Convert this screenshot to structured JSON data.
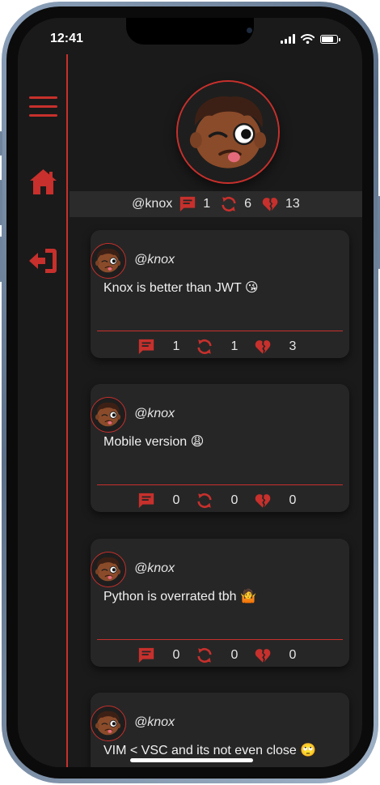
{
  "status_bar": {
    "time": "12:41",
    "battery_level": 0.9
  },
  "sidebar": {
    "items": [
      {
        "icon": "hamburger-menu-icon"
      },
      {
        "icon": "home-icon"
      },
      {
        "icon": "sign-out-icon"
      }
    ]
  },
  "profile": {
    "handle": "@knox",
    "stats": {
      "comments": "1",
      "reposts": "6",
      "dislikes": "13"
    }
  },
  "posts": [
    {
      "user": "@knox",
      "text": "Knox is better than JWT 😘",
      "comments": "1",
      "reposts": "1",
      "dislikes": "3"
    },
    {
      "user": "@knox",
      "text": "Mobile version 😩",
      "comments": "0",
      "reposts": "0",
      "dislikes": "0"
    },
    {
      "user": "@knox",
      "text": "Python is overrated tbh 🤷",
      "comments": "0",
      "reposts": "0",
      "dislikes": "0"
    },
    {
      "user": "@knox",
      "text": "VIM < VSC and its not even close 🙄",
      "comments": "",
      "reposts": "",
      "dislikes": ""
    }
  ],
  "colors": {
    "accent": "#c7302c",
    "background": "#1a1a1a",
    "card": "#262626",
    "stats_bar": "#2b2b2b",
    "text": "#e6e6e6"
  }
}
